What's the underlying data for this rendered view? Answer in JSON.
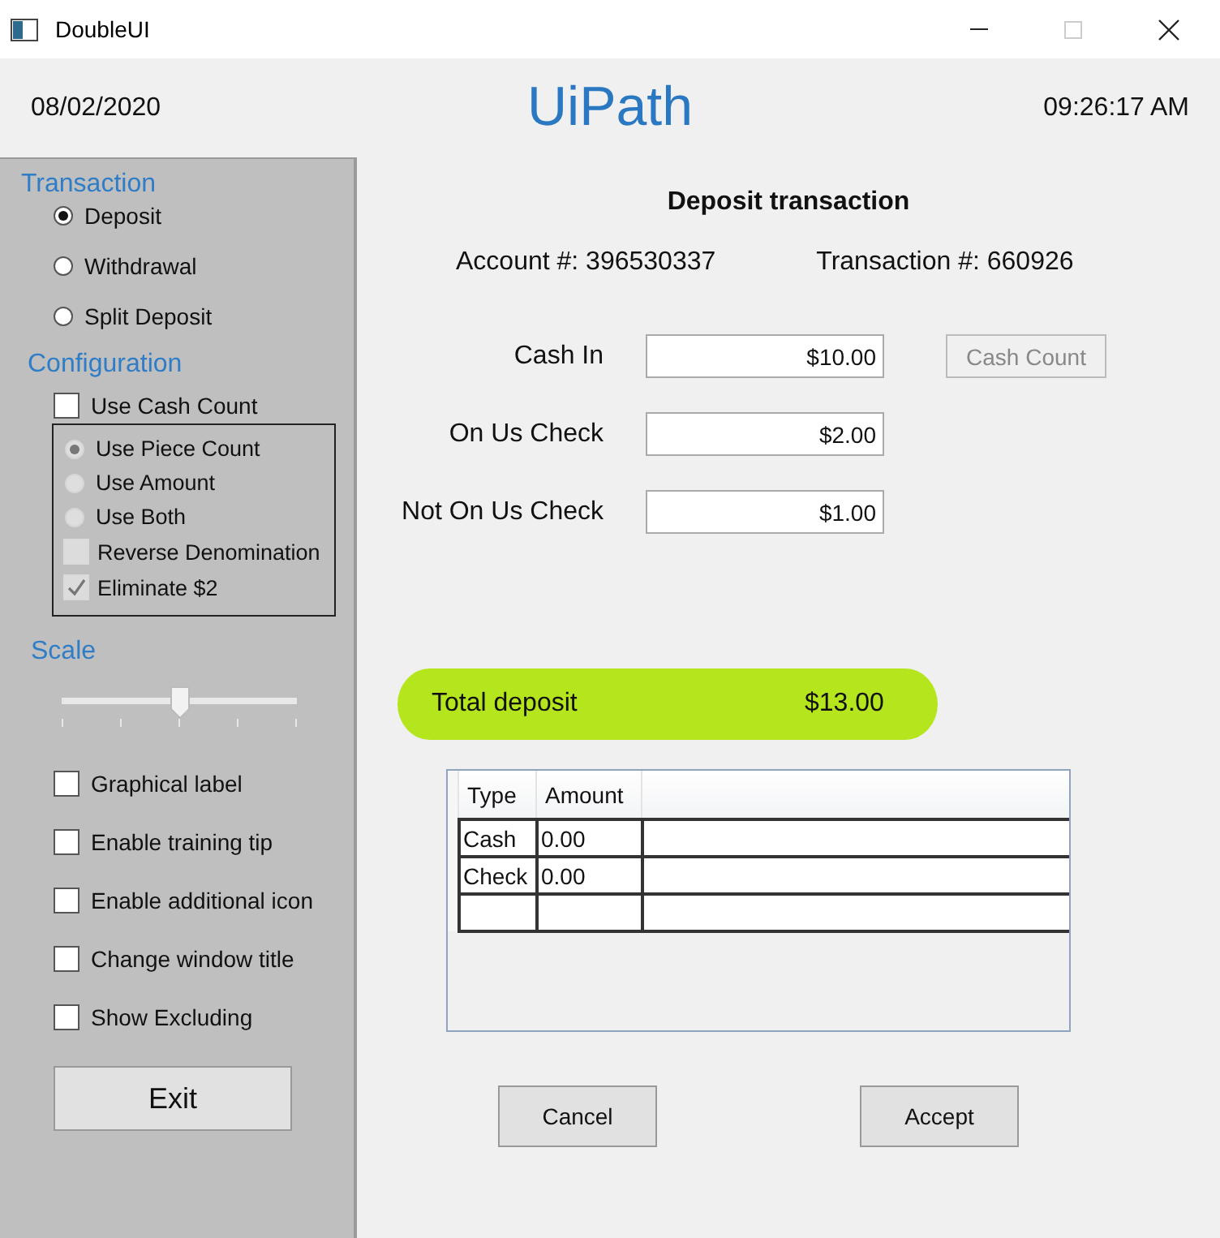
{
  "window": {
    "title": "DoubleUI"
  },
  "header": {
    "date": "08/02/2020",
    "logo": "UiPath",
    "time": "09:26:17 AM"
  },
  "sidebar": {
    "transaction": {
      "label": "Transaction",
      "options": [
        {
          "label": "Deposit",
          "selected": true
        },
        {
          "label": "Withdrawal",
          "selected": false
        },
        {
          "label": "Split Deposit",
          "selected": false
        }
      ]
    },
    "configuration": {
      "label": "Configuration",
      "use_cash_count": {
        "label": "Use Cash Count",
        "checked": false
      },
      "modes": [
        {
          "label": "Use Piece Count",
          "selected": true,
          "disabled": true
        },
        {
          "label": "Use Amount",
          "selected": false,
          "disabled": true
        },
        {
          "label": "Use Both",
          "selected": false,
          "disabled": true
        }
      ],
      "options": [
        {
          "label": "Reverse Denomination",
          "checked": false,
          "disabled": true
        },
        {
          "label": "Eliminate $2",
          "checked": true,
          "disabled": true
        }
      ]
    },
    "scale": {
      "label": "Scale",
      "level": 0.5
    },
    "toggles": [
      {
        "label": "Graphical label",
        "checked": false
      },
      {
        "label": "Enable training tip",
        "checked": false
      },
      {
        "label": "Enable additional icon",
        "checked": false
      },
      {
        "label": "Change window title",
        "checked": false
      },
      {
        "label": "Show Excluding",
        "checked": false
      }
    ],
    "exit_button": "Exit"
  },
  "main": {
    "title": "Deposit transaction",
    "account": "Account #: 396530337",
    "transaction": "Transaction #: 660926",
    "fields": [
      {
        "label": "Cash In",
        "value": "$10.00"
      },
      {
        "label": "On Us Check",
        "value": "$2.00"
      },
      {
        "label": "Not On Us Check",
        "value": "$1.00"
      }
    ],
    "cash_count_button": {
      "label": "Cash Count",
      "disabled": true
    },
    "total": {
      "label": "Total deposit",
      "value": "$13.00"
    },
    "table": {
      "columns": [
        "Type",
        "Amount"
      ],
      "rows": [
        {
          "cells": [
            "Cash",
            "0.00"
          ]
        },
        {
          "cells": [
            "Check",
            "0.00"
          ]
        }
      ]
    },
    "buttons": [
      {
        "label": "Cancel"
      },
      {
        "label": "Accept"
      }
    ]
  }
}
